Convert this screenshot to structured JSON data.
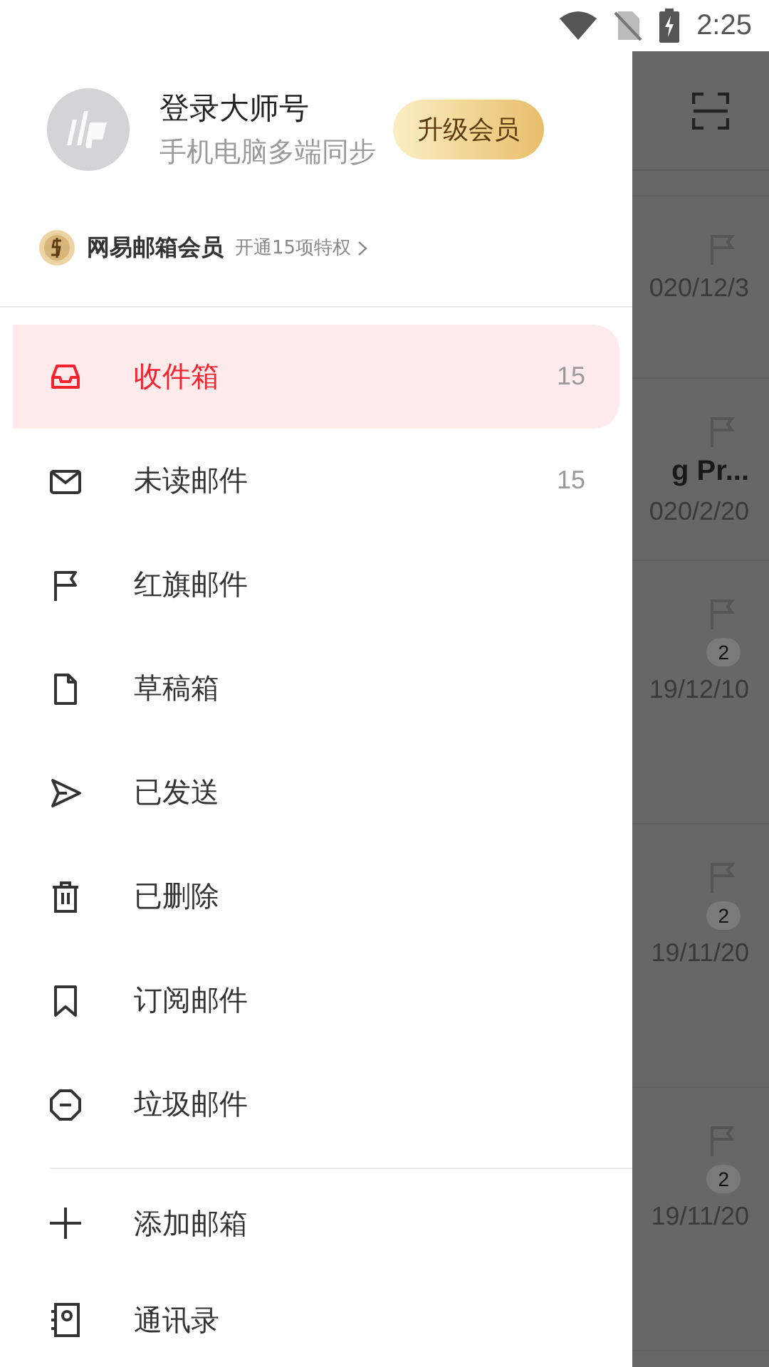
{
  "status_bar": {
    "time": "2:25"
  },
  "drawer": {
    "account": {
      "title": "登录大师号",
      "subtitle": "手机电脑多端同步",
      "upgrade_button": "升级会员"
    },
    "membership": {
      "title": "网易邮箱会员",
      "link": "开通15项特权"
    },
    "folders": [
      {
        "kind": "inbox",
        "label": "收件箱",
        "count": "15",
        "selected": true
      },
      {
        "kind": "unread",
        "label": "未读邮件",
        "count": "15",
        "selected": false
      },
      {
        "kind": "flagged",
        "label": "红旗邮件",
        "selected": false
      },
      {
        "kind": "drafts",
        "label": "草稿箱",
        "selected": false
      },
      {
        "kind": "sent",
        "label": "已发送",
        "selected": false
      },
      {
        "kind": "deleted",
        "label": "已删除",
        "selected": false
      },
      {
        "kind": "subscriptions",
        "label": "订阅邮件",
        "selected": false
      },
      {
        "kind": "spam",
        "label": "垃圾邮件",
        "selected": false
      }
    ],
    "actions": [
      {
        "kind": "add",
        "label": "添加邮箱"
      },
      {
        "kind": "contacts",
        "label": "通讯录"
      }
    ]
  },
  "mail_list": {
    "rows": [
      {
        "date": "020/12/3"
      },
      {
        "subject": "g Pr...",
        "date": "020/2/20"
      },
      {
        "count": "2",
        "date": "19/12/10"
      },
      {
        "count": "2",
        "date": "19/11/20"
      },
      {
        "count": "2",
        "date": "19/11/20"
      }
    ]
  }
}
